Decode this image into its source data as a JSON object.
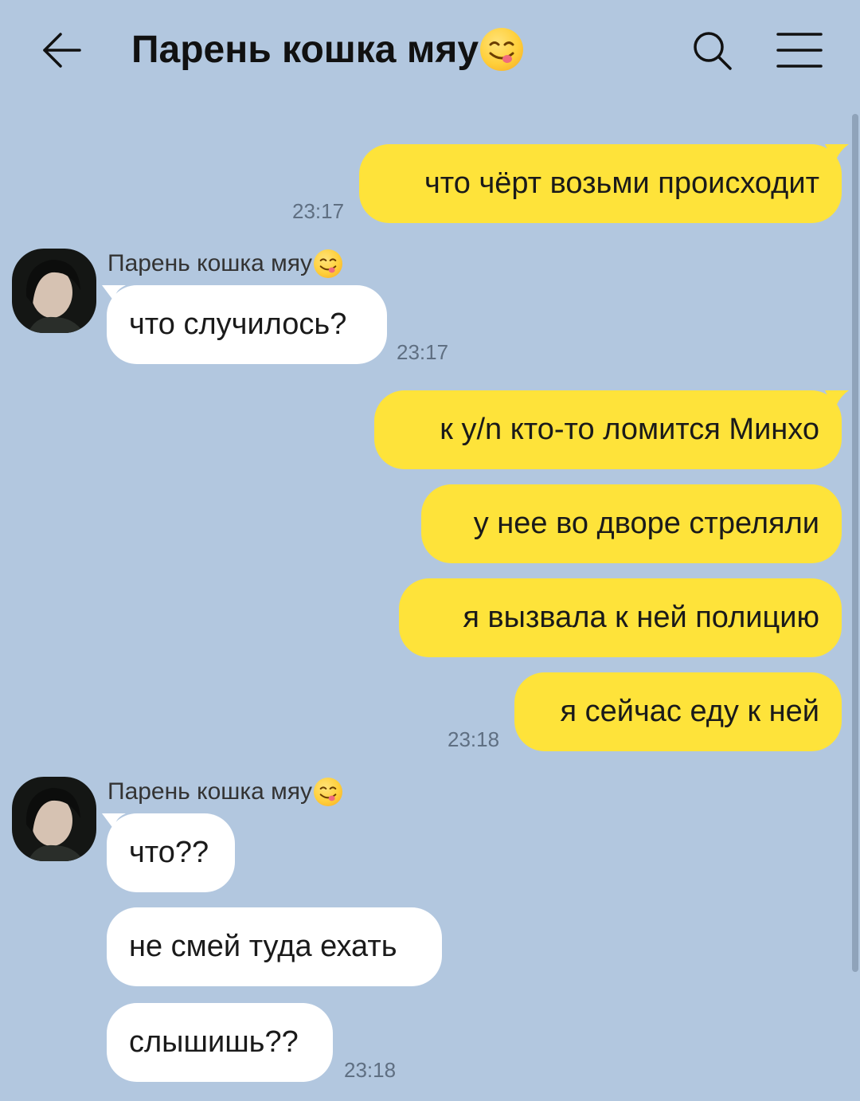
{
  "header": {
    "title": "Парень кошка мяу",
    "title_emoji": "face-savoring-food-emoji"
  },
  "colors": {
    "background": "#b2c7df",
    "outgoing_bubble": "#fee33a",
    "incoming_bubble": "#ffffff",
    "timestamp": "#5f6f82"
  },
  "messages": [
    {
      "direction": "out",
      "text": "что чёрт возьми происходит",
      "time": "23:17"
    },
    {
      "direction": "in",
      "sender": "Парень кошка мяу",
      "text": "что случилось?",
      "time": "23:17"
    },
    {
      "direction": "out",
      "text": "к y/n кто-то ломится Минхо"
    },
    {
      "direction": "out",
      "text": "у нее во дворе стреляли"
    },
    {
      "direction": "out",
      "text": "я вызвала к ней полицию"
    },
    {
      "direction": "out",
      "text": "я сейчас еду к ней",
      "time": "23:18"
    },
    {
      "direction": "in",
      "sender": "Парень кошка мяу",
      "text": "что??"
    },
    {
      "direction": "in",
      "text": "не смей туда ехать"
    },
    {
      "direction": "in",
      "text": "слышишь??",
      "time": "23:18"
    }
  ]
}
